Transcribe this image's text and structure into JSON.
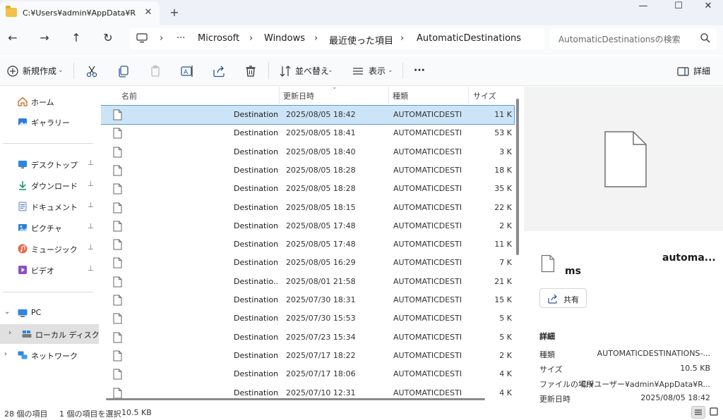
{
  "tab": {
    "title": "C:¥Users¥admin¥AppData¥Ro",
    "close": "✕",
    "new": "+"
  },
  "window": {
    "minimize": "—",
    "maximize": "☐",
    "close": "✕"
  },
  "nav": {
    "back": "←",
    "forward": "→",
    "up": "↑",
    "refresh": "↻",
    "breadcrumb": [
      "Microsoft",
      "Windows",
      "最近使った項目",
      "AutomaticDestinations"
    ],
    "more": "···",
    "sep": "›",
    "search_placeholder": "AutomaticDestinationsの検索"
  },
  "toolbar": {
    "new": "新規作成",
    "sort": "並べ替え",
    "view": "表示",
    "more": "···",
    "details": "詳細"
  },
  "sidebar": {
    "items": [
      {
        "label": "ホーム",
        "icon": "home-icon"
      },
      {
        "label": "ギャラリー",
        "icon": "gallery-icon"
      },
      {
        "label": "デスクトップ",
        "icon": "desktop-icon",
        "pinned": true
      },
      {
        "label": "ダウンロード",
        "icon": "download-icon",
        "pinned": true
      },
      {
        "label": "ドキュメント",
        "icon": "documents-icon",
        "pinned": true
      },
      {
        "label": "ピクチャ",
        "icon": "pictures-icon",
        "pinned": true
      },
      {
        "label": "ミュージック",
        "icon": "music-icon",
        "pinned": true
      },
      {
        "label": "ビデオ",
        "icon": "video-icon",
        "pinned": true
      },
      {
        "label": "PC",
        "icon": "pc-icon"
      },
      {
        "label": "ローカル ディスク (C:)",
        "icon": "drive-icon"
      },
      {
        "label": "ネットワーク",
        "icon": "network-icon"
      }
    ],
    "chevron_open": "⌄",
    "chevron_closed": "›",
    "pin": "📌"
  },
  "columns": {
    "name": "名前",
    "date": "更新日時",
    "type": "種類",
    "size": "サイズ"
  },
  "files": [
    {
      "name": "Destination...",
      "date": "2025/08/05 18:42",
      "type": "AUTOMATICDESTI...",
      "size": "11 K",
      "selected": true
    },
    {
      "name": "Destinations...",
      "date": "2025/08/05 18:41",
      "type": "AUTOMATICDESTI...",
      "size": "53 K"
    },
    {
      "name": "Destinations...",
      "date": "2025/08/05 18:40",
      "type": "AUTOMATICDESTI...",
      "size": "3 K"
    },
    {
      "name": "Destinations...",
      "date": "2025/08/05 18:28",
      "type": "AUTOMATICDESTI...",
      "size": "18 K"
    },
    {
      "name": "Destinations...",
      "date": "2025/08/05 18:28",
      "type": "AUTOMATICDESTI...",
      "size": "35 K"
    },
    {
      "name": "Destination...",
      "date": "2025/08/05 18:15",
      "type": "AUTOMATICDESTI...",
      "size": "22 K"
    },
    {
      "name": "Destination...",
      "date": "2025/08/05 17:48",
      "type": "AUTOMATICDESTI...",
      "size": "2 K"
    },
    {
      "name": "Destinations-...",
      "date": "2025/08/05 17:48",
      "type": "AUTOMATICDESTI...",
      "size": "11 K"
    },
    {
      "name": "Destination...",
      "date": "2025/08/05 16:29",
      "type": "AUTOMATICDESTI...",
      "size": "7 K"
    },
    {
      "name": "Destinatio...",
      "date": "2025/08/01 21:58",
      "type": "AUTOMATICDESTI...",
      "size": "21 K"
    },
    {
      "name": "Destination...",
      "date": "2025/07/30 18:31",
      "type": "AUTOMATICDESTI...",
      "size": "15 K"
    },
    {
      "name": "Destinations...",
      "date": "2025/07/30 15:53",
      "type": "AUTOMATICDESTI...",
      "size": "5 K"
    },
    {
      "name": "Destinations...",
      "date": "2025/07/23 15:34",
      "type": "AUTOMATICDESTI...",
      "size": "5 K"
    },
    {
      "name": "Destination...",
      "date": "2025/07/17 18:22",
      "type": "AUTOMATICDESTI...",
      "size": "2 K"
    },
    {
      "name": "Destination...",
      "date": "2025/07/17 18:06",
      "type": "AUTOMATICDESTI...",
      "size": "4 K"
    },
    {
      "name": "Destinations...",
      "date": "2025/07/10 12:31",
      "type": "AUTOMATICDESTI...",
      "size": "4 K"
    }
  ],
  "details": {
    "file_name_line1": "automa...",
    "file_name_line2": "ms",
    "share": "共有",
    "section": "詳細",
    "rows": [
      {
        "label": "種類",
        "value": "AUTOMATICDESTINATIONS-..."
      },
      {
        "label": "サイズ",
        "value": "10.5 KB"
      },
      {
        "label": "ファイルの場所",
        "value": "C:¥ユーザー¥admin¥AppData¥R..."
      },
      {
        "label": "更新日時",
        "value": "2025/08/05 18:42"
      }
    ]
  },
  "status": {
    "count": "28 個の項目",
    "selected": "1 個の項目を選択",
    "size": "10.5 KB"
  }
}
